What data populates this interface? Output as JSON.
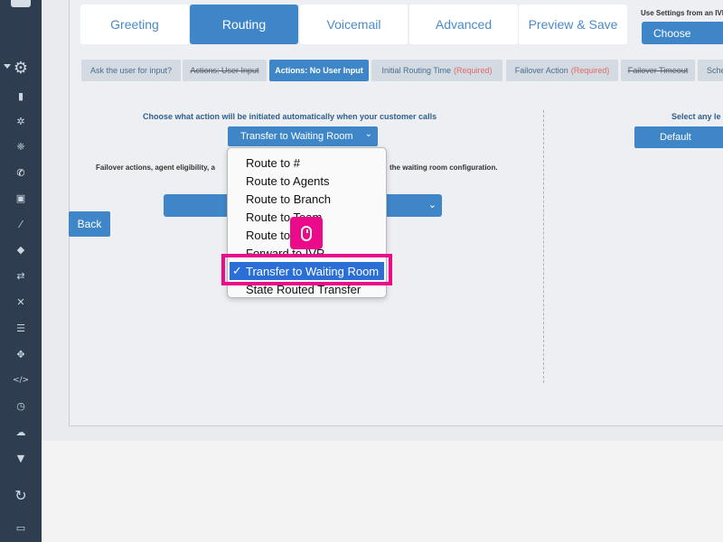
{
  "tabs": [
    {
      "label": "Greeting"
    },
    {
      "label": "Routing"
    },
    {
      "label": "Voicemail"
    },
    {
      "label": "Advanced"
    },
    {
      "label": "Preview & Save"
    }
  ],
  "ivr_settings": {
    "label": "Use Settings from an IVR",
    "choose_label": "Choose"
  },
  "subtabs": [
    {
      "label": "Ask the user for input?"
    },
    {
      "label": "Actions: User Input"
    },
    {
      "label": "Actions: No User Input"
    },
    {
      "label": "Initial Routing Time",
      "req": "(Required)"
    },
    {
      "label": "Failover Action",
      "req": "(Required)"
    },
    {
      "label": "Failover Timeout"
    },
    {
      "label": "Sche"
    }
  ],
  "main": {
    "heading": "Choose what action will be initiated automatically when your customer calls",
    "selected_value": "Transfer to Waiting Room",
    "failover_left": "Failover actions, agent eligibility, a",
    "failover_right": "the waiting room configuration.",
    "right_heading": "Select any le",
    "default_label": "Default",
    "back_label": "Back"
  },
  "dropdown": {
    "options": [
      {
        "label": "Route to #"
      },
      {
        "label": "Route to Agents"
      },
      {
        "label": "Route to Branch"
      },
      {
        "label": "Route to Team"
      },
      {
        "label": "Route to"
      },
      {
        "label": "Forward to IVR"
      },
      {
        "label": "Transfer to Waiting Room",
        "selected": true
      },
      {
        "label": "State Routed Transfer"
      }
    ],
    "checkmark": "✓"
  },
  "colors": {
    "accent": "#3f86c8",
    "highlight": "#ea0a8a",
    "sidebar": "#2e3d50",
    "required": "#e0696a"
  },
  "icons": [
    "settings-gear-icon",
    "phone-icon",
    "tag-icon",
    "code-icon",
    "clock-icon",
    "filter-icon",
    "cloud-upload-icon",
    "mouse-click-icon"
  ]
}
